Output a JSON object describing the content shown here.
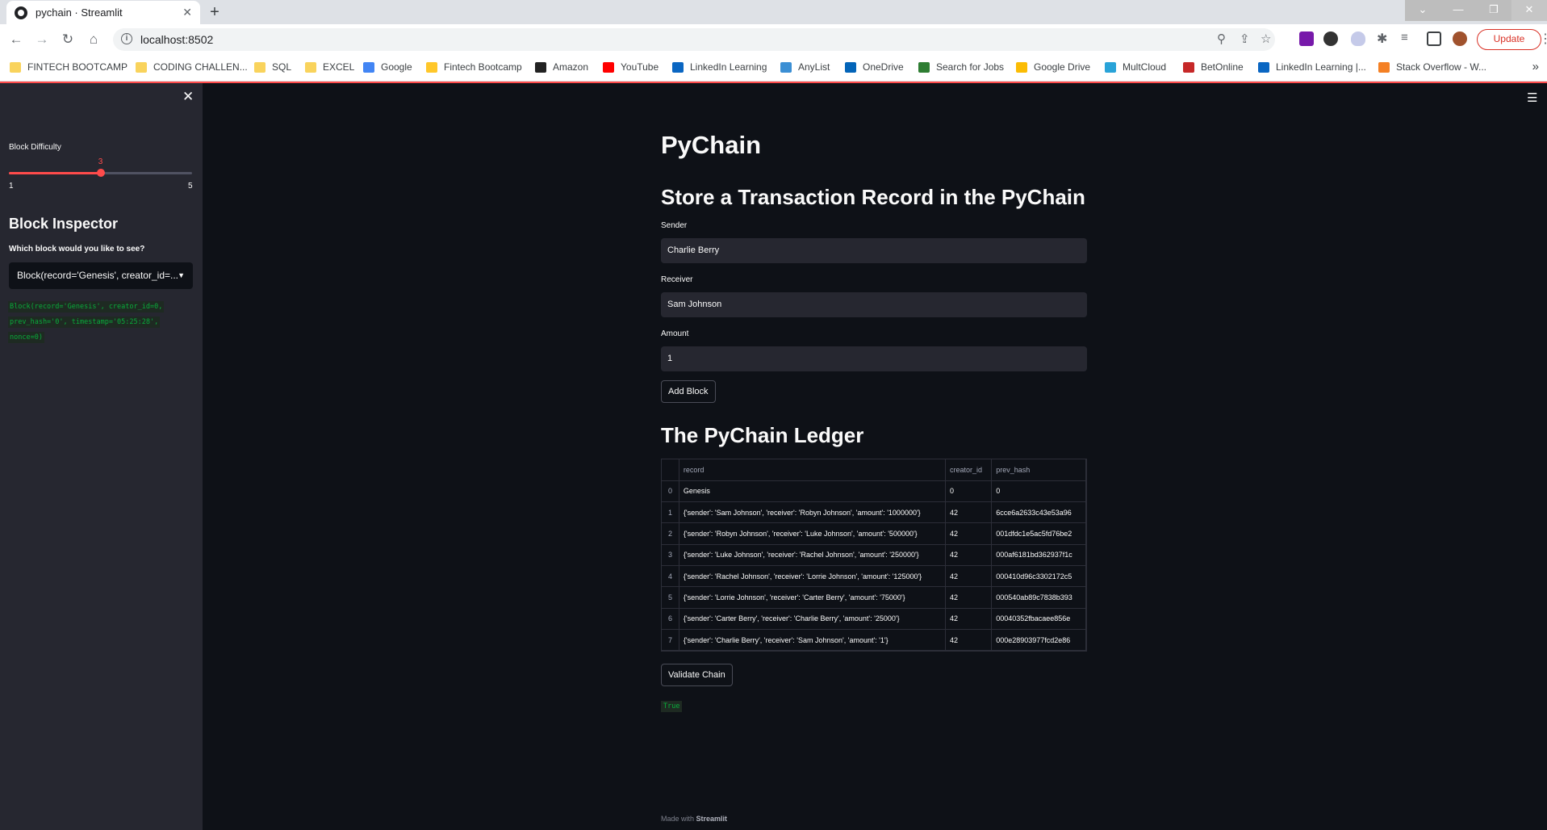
{
  "browser": {
    "tab_title": "pychain · Streamlit",
    "tab_close": "✕",
    "new_tab": "+",
    "url": "localhost:8502",
    "update_label": "Update",
    "bookmarks": [
      {
        "label": "FINTECH BOOTCAMP",
        "icon": "folder-icon",
        "color": "#f9d35c"
      },
      {
        "label": "CODING CHALLEN...",
        "icon": "folder-icon",
        "color": "#f9d35c"
      },
      {
        "label": "SQL",
        "icon": "folder-icon",
        "color": "#f9d35c"
      },
      {
        "label": "EXCEL",
        "icon": "folder-icon",
        "color": "#f9d35c"
      },
      {
        "label": "Google",
        "icon": "google-icon",
        "color": "#4285f4"
      },
      {
        "label": "Fintech Bootcamp",
        "icon": "umn-icon",
        "color": "#ffc72a"
      },
      {
        "label": "Amazon",
        "icon": "amazon-icon",
        "color": "#222222"
      },
      {
        "label": "YouTube",
        "icon": "youtube-icon",
        "color": "#ff0000"
      },
      {
        "label": "LinkedIn Learning",
        "icon": "linkedin-learning-icon",
        "color": "#0a66c2"
      },
      {
        "label": "AnyList",
        "icon": "anylist-icon",
        "color": "#3b8fd4"
      },
      {
        "label": "OneDrive",
        "icon": "onedrive-icon",
        "color": "#0364b8"
      },
      {
        "label": "Search for Jobs",
        "icon": "jobs-icon",
        "color": "#2e7d32"
      },
      {
        "label": "Google Drive",
        "icon": "google-drive-icon",
        "color": "#fbbc04"
      },
      {
        "label": "MultCloud",
        "icon": "multcloud-icon",
        "color": "#29a3d8"
      },
      {
        "label": "BetOnline",
        "icon": "betonline-icon",
        "color": "#c62828"
      },
      {
        "label": "LinkedIn Learning |...",
        "icon": "linkedin-learning-icon",
        "color": "#0a66c2"
      },
      {
        "label": "Stack Overflow - W...",
        "icon": "stackoverflow-icon",
        "color": "#f48024"
      }
    ]
  },
  "sidebar": {
    "close_glyph": "✕",
    "slider": {
      "label": "Block Difficulty",
      "value": 3,
      "min": 1,
      "max": 5,
      "value_text": "3",
      "min_text": "1",
      "max_text": "5"
    },
    "inspector_title": "Block Inspector",
    "select_label": "Which block would you like to see?",
    "select_value": "Block(record='Genesis', creator_id=...",
    "code_lines": [
      "Block(record='Genesis', creator_id=0,",
      "prev_hash='0', timestamp='05:25:28',",
      "nonce=0)"
    ]
  },
  "main": {
    "menu_glyph": "☰",
    "title": "PyChain",
    "form_title": "Store a Transaction Record in the PyChain",
    "sender_label": "Sender",
    "sender_value": "Charlie Berry",
    "receiver_label": "Receiver",
    "receiver_value": "Sam Johnson",
    "amount_label": "Amount",
    "amount_value": "1",
    "add_block_label": "Add Block",
    "ledger_title": "The PyChain Ledger",
    "ledger": {
      "columns": [
        "",
        "record",
        "creator_id",
        "prev_hash"
      ],
      "rows": [
        [
          "0",
          "Genesis",
          "0",
          "0"
        ],
        [
          "1",
          "{'sender': 'Sam Johnson', 'receiver': 'Robyn Johnson', 'amount': '1000000'}",
          "42",
          "6cce6a2633c43e53a96"
        ],
        [
          "2",
          "{'sender': 'Robyn Johnson', 'receiver': 'Luke Johnson', 'amount': '500000'}",
          "42",
          "001dfdc1e5ac5fd76be2"
        ],
        [
          "3",
          "{'sender': 'Luke Johnson', 'receiver': 'Rachel Johnson', 'amount': '250000'}",
          "42",
          "000af6181bd362937f1c"
        ],
        [
          "4",
          "{'sender': 'Rachel Johnson', 'receiver': 'Lorrie Johnson', 'amount': '125000'}",
          "42",
          "000410d96c3302172c5"
        ],
        [
          "5",
          "{'sender': 'Lorrie Johnson', 'receiver': 'Carter Berry', 'amount': '75000'}",
          "42",
          "000540ab89c7838b393"
        ],
        [
          "6",
          "{'sender': 'Carter Berry', 'receiver': 'Charlie Berry', 'amount': '25000'}",
          "42",
          "00040352fbacaee856e"
        ],
        [
          "7",
          "{'sender': 'Charlie Berry', 'receiver': 'Sam Johnson', 'amount': '1'}",
          "42",
          "000e28903977fcd2e86"
        ]
      ]
    },
    "validate_label": "Validate Chain",
    "validate_result": "True",
    "footer_prefix": "Made with ",
    "footer_brand": "Streamlit"
  },
  "colors": {
    "accent": "#ff4b4b",
    "code_green": "#09ab3b",
    "background": "#0e1117",
    "sidebar_bg": "#262730"
  }
}
